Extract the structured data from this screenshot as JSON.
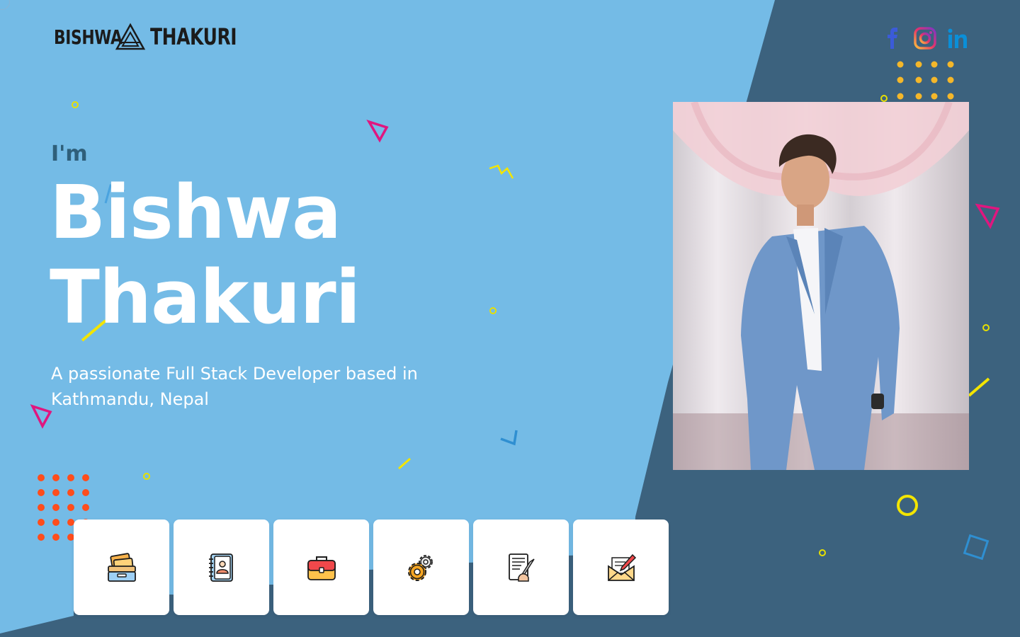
{
  "brand": {
    "first": "BISHWA",
    "last": "THAKURI",
    "logo_icon": "triangle-logo-icon"
  },
  "social": [
    {
      "name": "facebook",
      "icon": "facebook-icon",
      "color": "#3b5bd9"
    },
    {
      "name": "instagram",
      "icon": "instagram-icon",
      "color": "#d6249f"
    },
    {
      "name": "linkedin",
      "icon": "linkedin-icon",
      "color": "#0a8fd8"
    }
  ],
  "hero": {
    "greeting": "I'm",
    "first_name": "Bishwa",
    "last_name": "Thakuri",
    "tagline": "A passionate Full Stack Developer based in Kathmandu, Nepal"
  },
  "colors": {
    "background_light": "#74bbe6",
    "background_dark": "#3c627e",
    "accent_pink": "#e0167f",
    "accent_yellow": "#f3e500",
    "accent_orange": "#ff4d1c",
    "dots_gold": "#f4b72a"
  },
  "nav": [
    {
      "name": "home",
      "icon": "drawer-icon"
    },
    {
      "name": "about",
      "icon": "contact-book-icon"
    },
    {
      "name": "portfolio",
      "icon": "briefcase-icon"
    },
    {
      "name": "skills",
      "icon": "gears-icon"
    },
    {
      "name": "blog",
      "icon": "document-quill-icon"
    },
    {
      "name": "contact",
      "icon": "envelope-pen-icon"
    }
  ],
  "photo": {
    "subject": "portrait-photo"
  }
}
